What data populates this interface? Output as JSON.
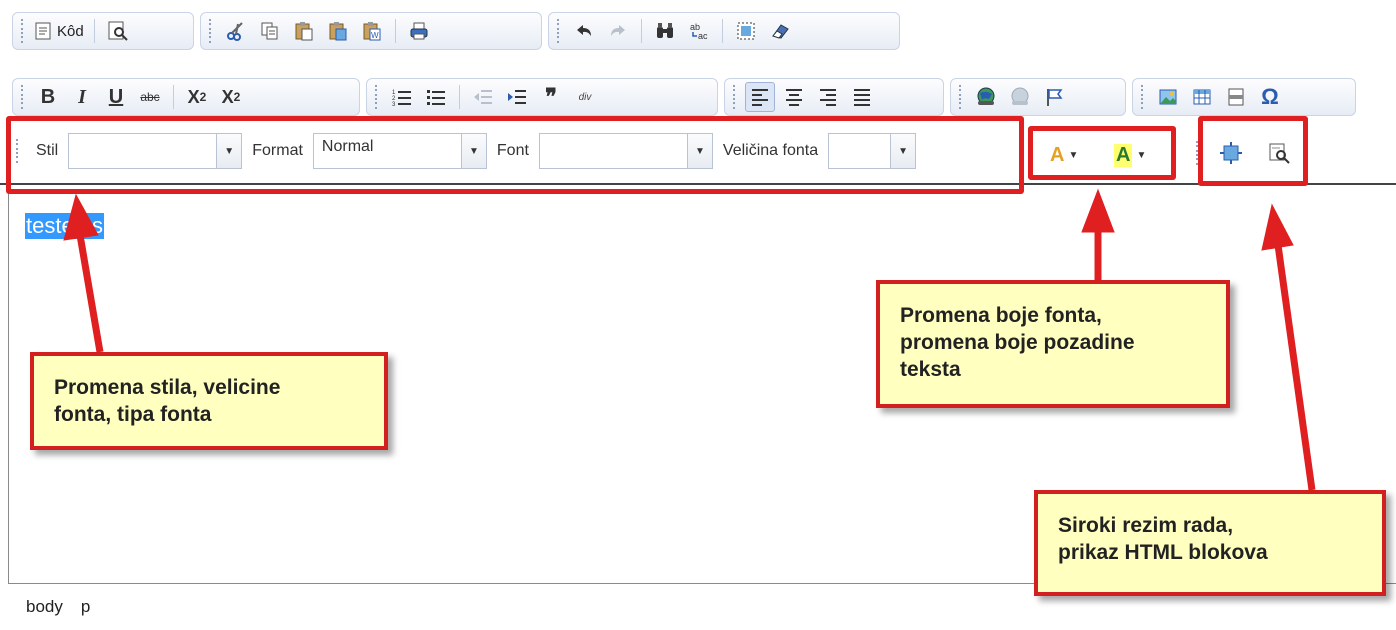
{
  "toolbar": {
    "source_label": "Kôd",
    "row1_icons": [
      "preview-icon",
      "cut-icon",
      "copy-icon",
      "paste-icon",
      "paste-text-icon",
      "paste-word-icon",
      "print-icon",
      "undo-icon",
      "redo-icon",
      "find-icon",
      "replace-icon",
      "select-all-icon",
      "remove-format-icon"
    ],
    "row2_icons": [
      "bold-icon",
      "italic-icon",
      "underline-icon",
      "strikethrough-icon",
      "subscript-icon",
      "superscript-icon",
      "numbered-list-icon",
      "bulleted-list-icon",
      "outdent-icon",
      "indent-icon",
      "blockquote-icon",
      "div-icon",
      "align-left-icon",
      "align-center-icon",
      "align-right-icon",
      "justify-icon",
      "link-icon",
      "unlink-icon",
      "anchor-icon",
      "image-icon",
      "table-icon",
      "horizontal-rule-icon",
      "special-char-icon"
    ],
    "bold_label": "B",
    "italic_label": "I",
    "underline_label": "U",
    "strike_label": "abc",
    "subscript_label": "X",
    "superscript_label": "X",
    "sub_index": "2",
    "sup_index": "2",
    "blockquote_label": "❞",
    "div_label": "div",
    "special_char_label": "Ω"
  },
  "combos": {
    "style_label": "Stil",
    "style_value": "",
    "format_label": "Format",
    "format_value": "Normal",
    "font_label": "Font",
    "font_value": "",
    "size_label": "Veličina fonta",
    "size_value": ""
  },
  "color_buttons": {
    "text_color_glyph": "A",
    "bg_color_glyph": "A"
  },
  "editor": {
    "content": "testetes"
  },
  "status_bar": {
    "path": [
      "body",
      "p"
    ]
  },
  "annotations": {
    "style_callout": "Promena stila, velicine\nfonta, tipa fonta",
    "color_callout": "Promena boje fonta,\npromena boje pozadine\nteksta",
    "mode_callout": "Siroki rezim rada,\nprikaz HTML blokova"
  },
  "colors": {
    "annotation_red": "#e02020",
    "callout_fill": "#ffffc0",
    "selection_blue": "#3399ff",
    "toolbar_border": "#c9d4e6"
  }
}
